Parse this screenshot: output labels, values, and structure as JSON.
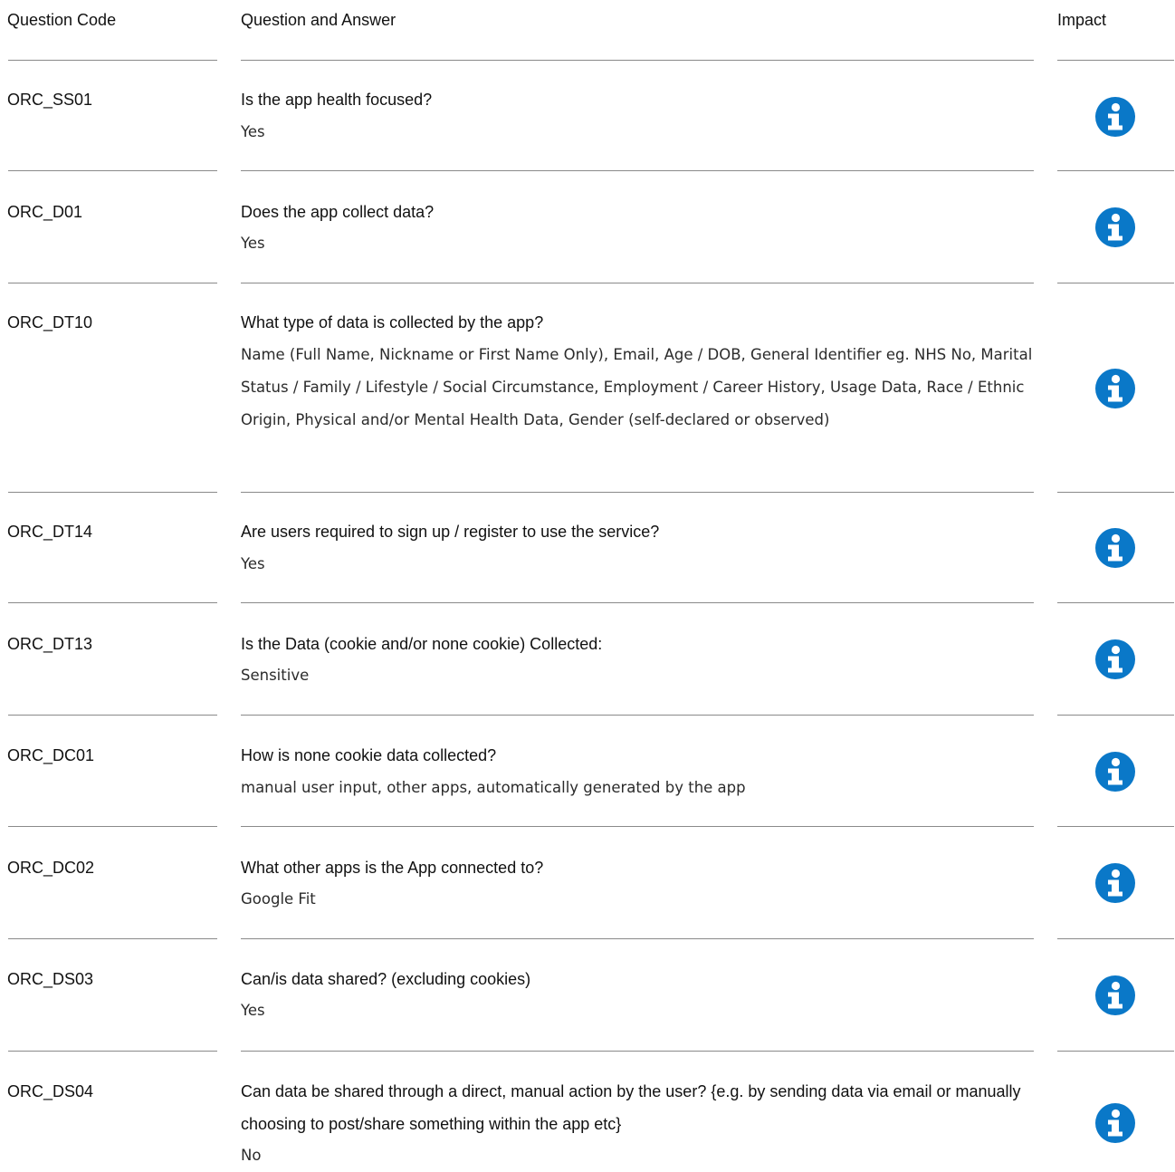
{
  "header": {
    "code": "Question Code",
    "qa": "Question and Answer",
    "impact": "Impact"
  },
  "colors": {
    "info_icon": "#0a78c8",
    "separator": "#8a8a8a"
  },
  "rows": [
    {
      "code": "ORC_SS01",
      "question": "Is the app health focused?",
      "answer": "Yes",
      "impact_icon": "info-icon"
    },
    {
      "code": "ORC_D01",
      "question": "Does the app collect data?",
      "answer": "Yes",
      "impact_icon": "info-icon"
    },
    {
      "code": "ORC_DT10",
      "question": "What type of data is collected by the app?",
      "answer": "Name (Full Name, Nickname or First Name Only), Email, Age / DOB, General Identifier eg. NHS No, Marital Status / Family / Lifestyle / Social Circumstance, Employment / Career History, Usage Data, Race / Ethnic Origin, Physical and/or Mental Health Data, Gender (self-declared or observed)",
      "impact_icon": "info-icon"
    },
    {
      "code": "ORC_DT14",
      "question": "Are users required to sign up / register to use the service?",
      "answer": "Yes",
      "impact_icon": "info-icon"
    },
    {
      "code": "ORC_DT13",
      "question": "Is the Data (cookie and/or none cookie) Collected:",
      "answer": "Sensitive",
      "impact_icon": "info-icon"
    },
    {
      "code": "ORC_DC01",
      "question": "How is none cookie data collected?",
      "answer": "manual user input, other apps, automatically generated by the app",
      "impact_icon": "info-icon"
    },
    {
      "code": "ORC_DC02",
      "question": "What other apps is the App connected to?",
      "answer": "Google Fit",
      "impact_icon": "info-icon"
    },
    {
      "code": "ORC_DS03",
      "question": "Can/is data shared? (excluding cookies)",
      "answer": "Yes",
      "impact_icon": "info-icon"
    },
    {
      "code": "ORC_DS04",
      "question": "Can data be shared through a direct, manual action by the user? {e.g. by sending data via email or manually choosing to post/share something within the app etc}",
      "answer": "No",
      "impact_icon": "info-icon"
    }
  ]
}
